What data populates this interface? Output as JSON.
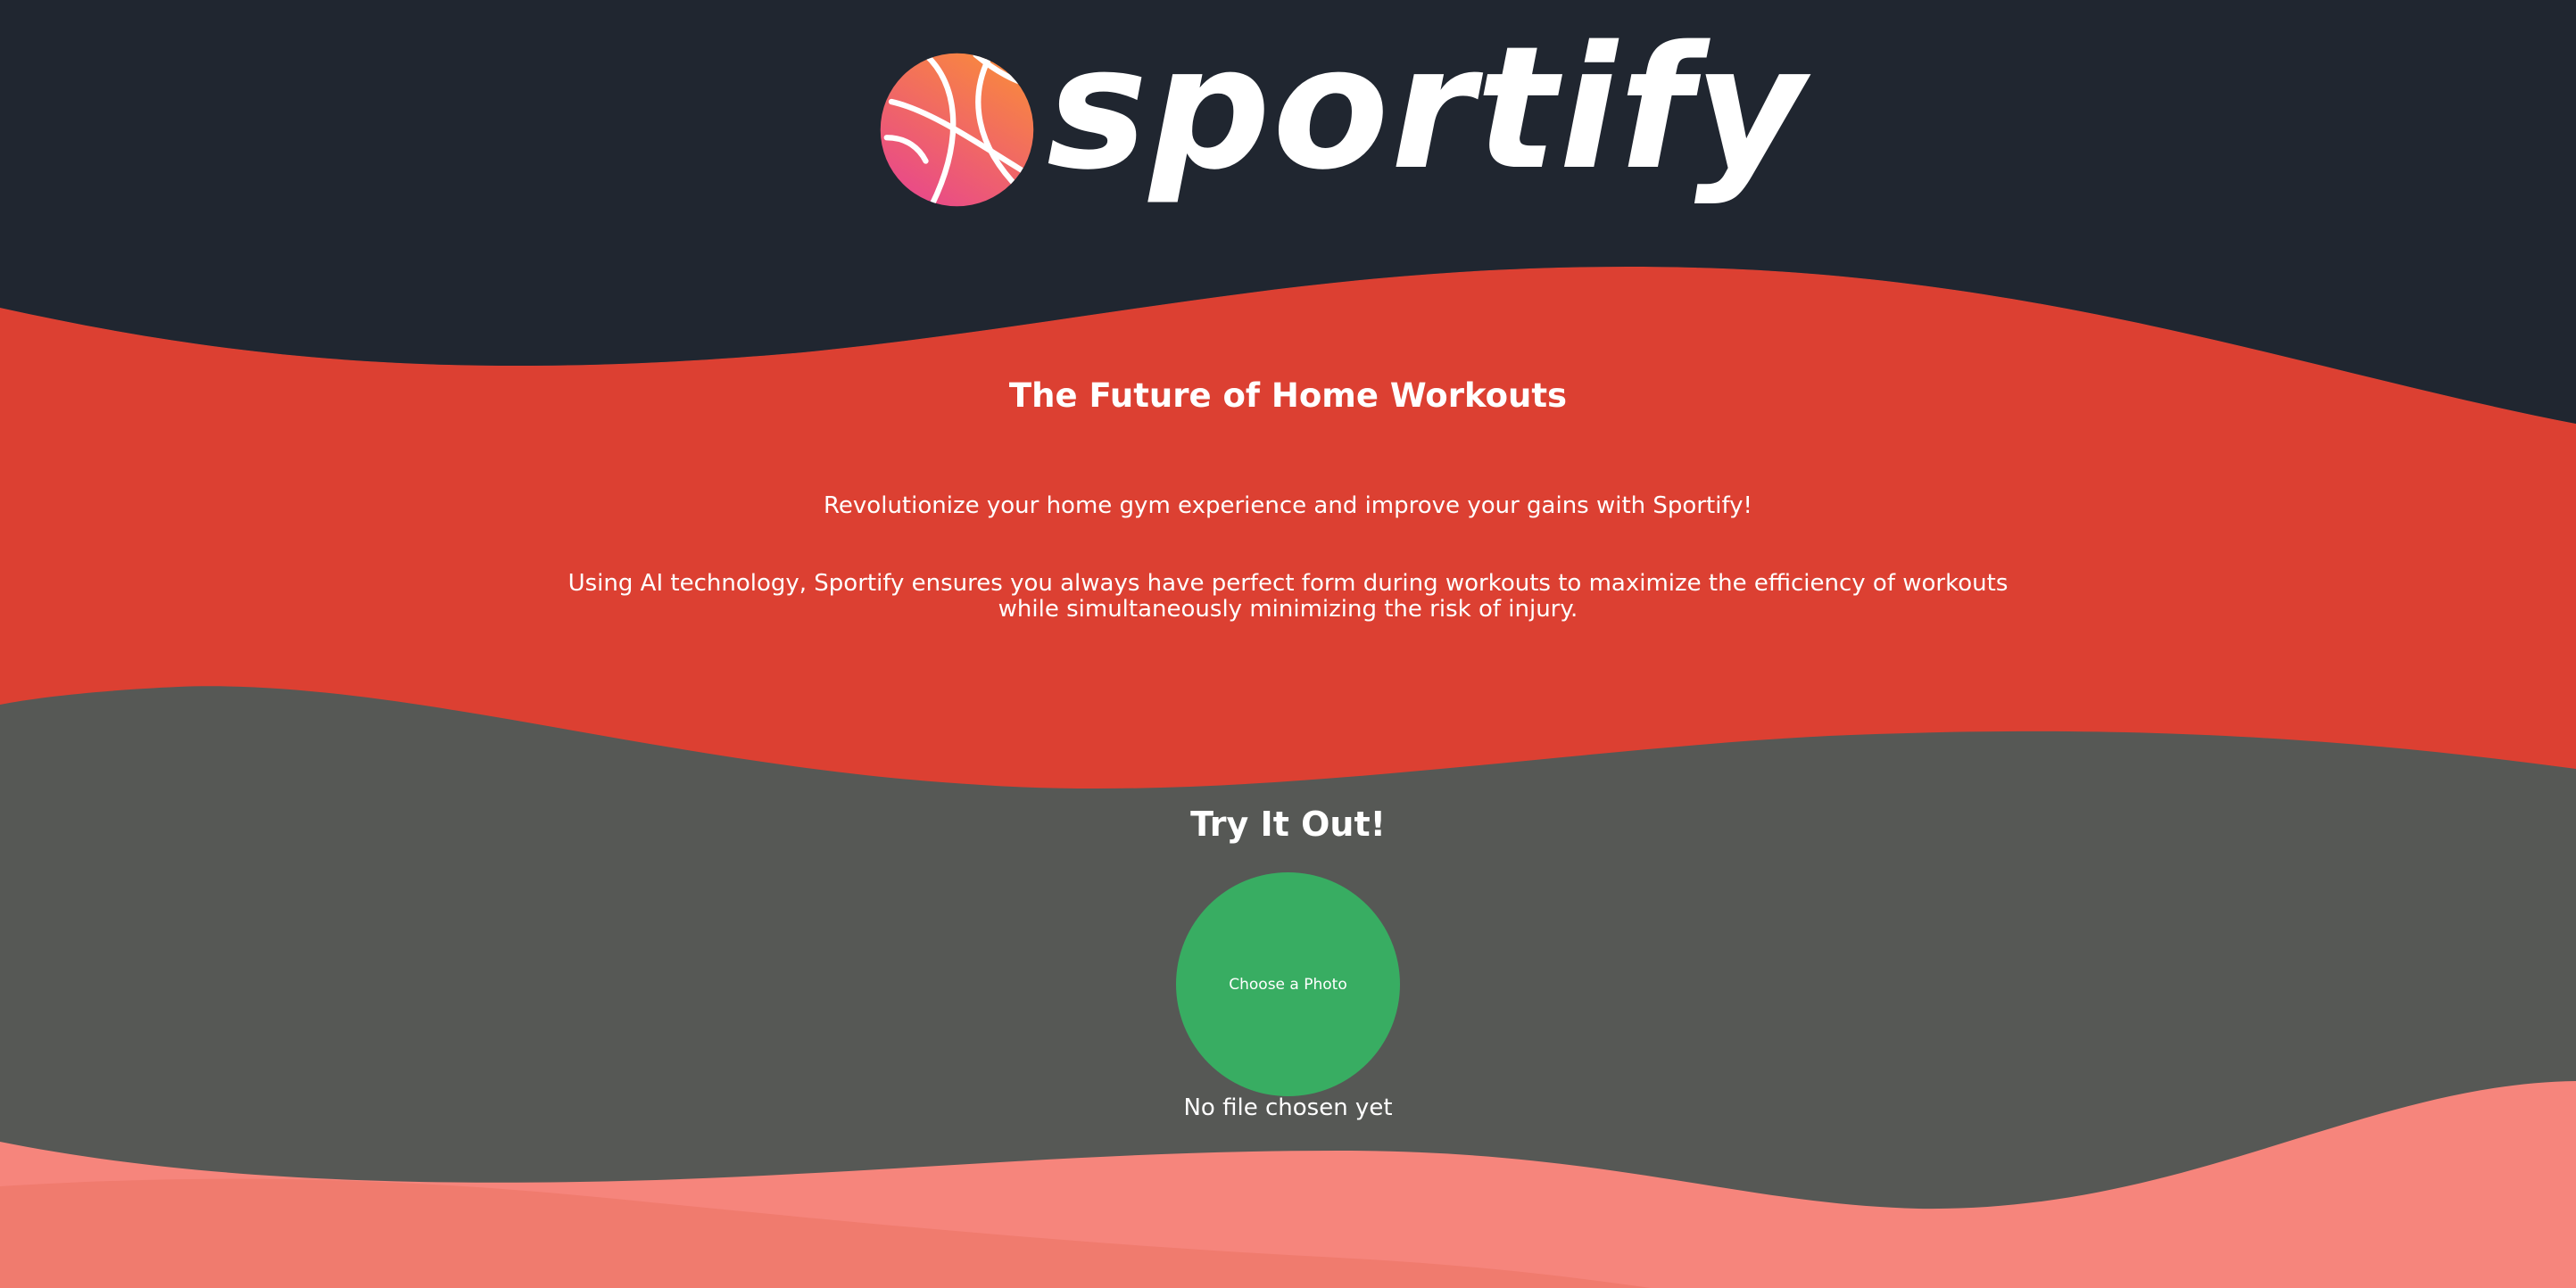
{
  "colors": {
    "header_bg": "#202630",
    "hero_bg": "#dc4032",
    "tryit_bg": "#565855",
    "footer_wave_light": "#f6857c",
    "footer_wave_dark": "#f07b6e",
    "button_green": "#38ad62",
    "text": "#ffffff"
  },
  "brand": {
    "logo_icon": "basketball-icon",
    "name": "sportify"
  },
  "hero": {
    "title": "The Future of Home Workouts",
    "tagline": "Revolutionize your home gym experience and improve your gains with Sportify!",
    "description": "Using AI technology, Sportify ensures you always have perfect form during workouts to maximize the efficiency of workouts while simultaneously minimizing the risk of injury."
  },
  "try_it": {
    "title": "Try It Out!",
    "button_label": "Choose a Photo",
    "file_status": "No file chosen yet"
  }
}
